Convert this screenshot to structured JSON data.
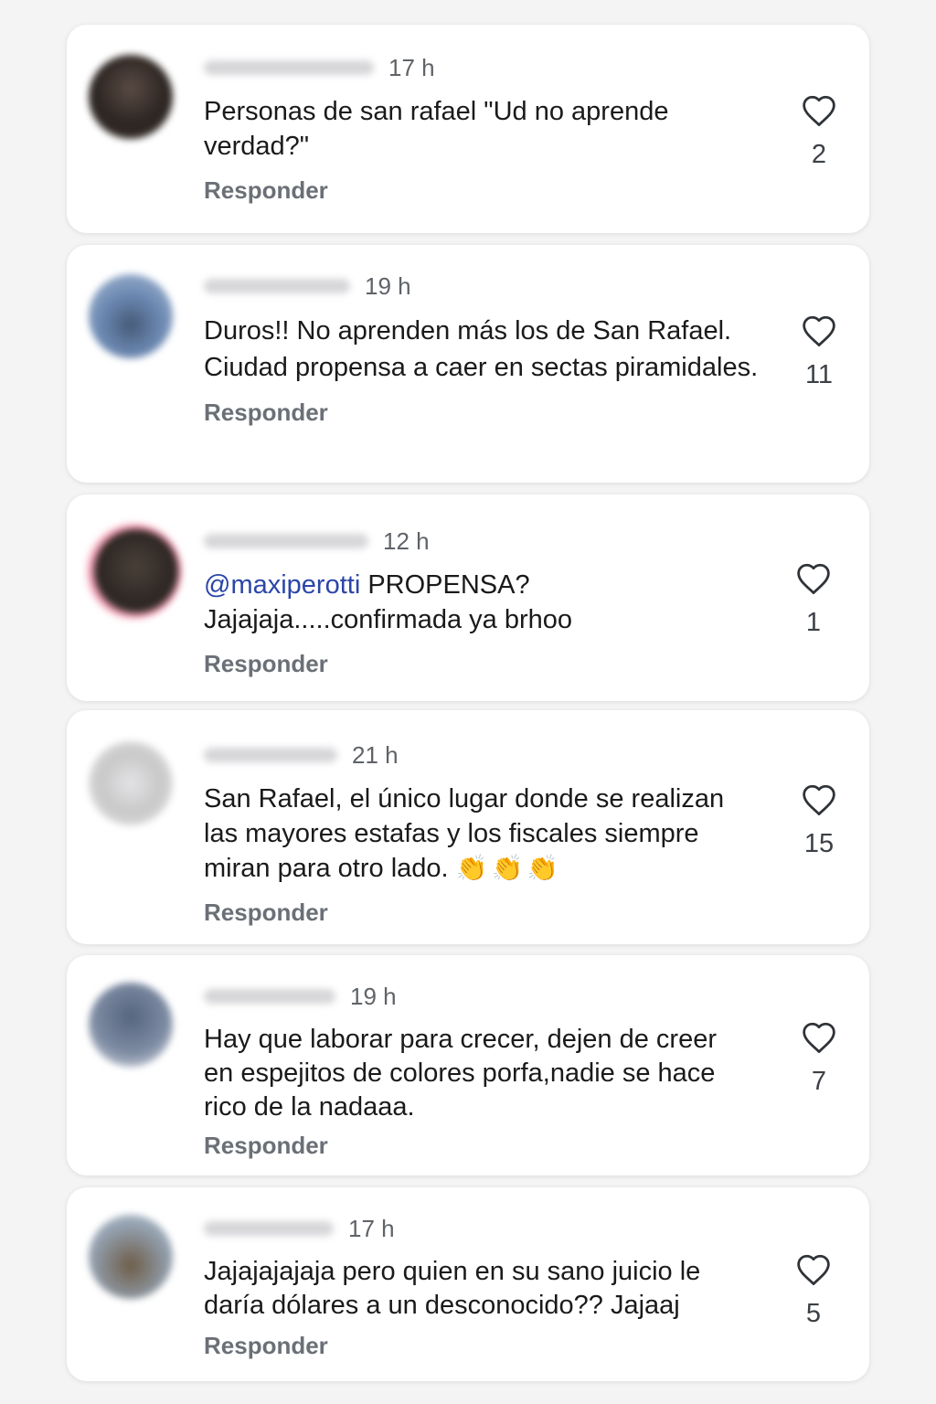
{
  "comments": [
    {
      "time": "17 h",
      "text": "Personas de san rafael \"Ud no aprende verdad?\"",
      "reply": "Responder",
      "likes": "2"
    },
    {
      "time": "19 h",
      "text": "Duros!! No aprenden más los de San Rafael. Ciudad propensa a caer en sectas piramidales.",
      "reply": "Responder",
      "likes": "11"
    },
    {
      "time": "12 h",
      "mention": "@maxiperotti",
      "text": " PROPENSA? Jajajaja.....confirmada ya brhoo",
      "reply": "Responder",
      "likes": "1"
    },
    {
      "time": "21 h",
      "text": "San Rafael, el único lugar donde se realizan las mayores estafas y los fiscales  siempre miran para otro lado.",
      "emoji": "👏👏👏",
      "reply": "Responder",
      "likes": "15"
    },
    {
      "time": "19 h",
      "text": "Hay que laborar para crecer, dejen de creer en espejitos de colores porfa,nadie se hace rico de la nadaaa.",
      "reply": "Responder",
      "likes": "7"
    },
    {
      "time": "17 h",
      "text": "Jajajajajaja pero quien en su sano juicio le daría dólares a un desconocido?? Jajaaj",
      "reply": "Responder",
      "likes": "5"
    }
  ],
  "colors": {
    "mention": "#2b45a8",
    "heart": "#2f3338"
  },
  "icons": {
    "like": "heart-outline-icon",
    "avatar": "blurred-profile-avatar"
  }
}
